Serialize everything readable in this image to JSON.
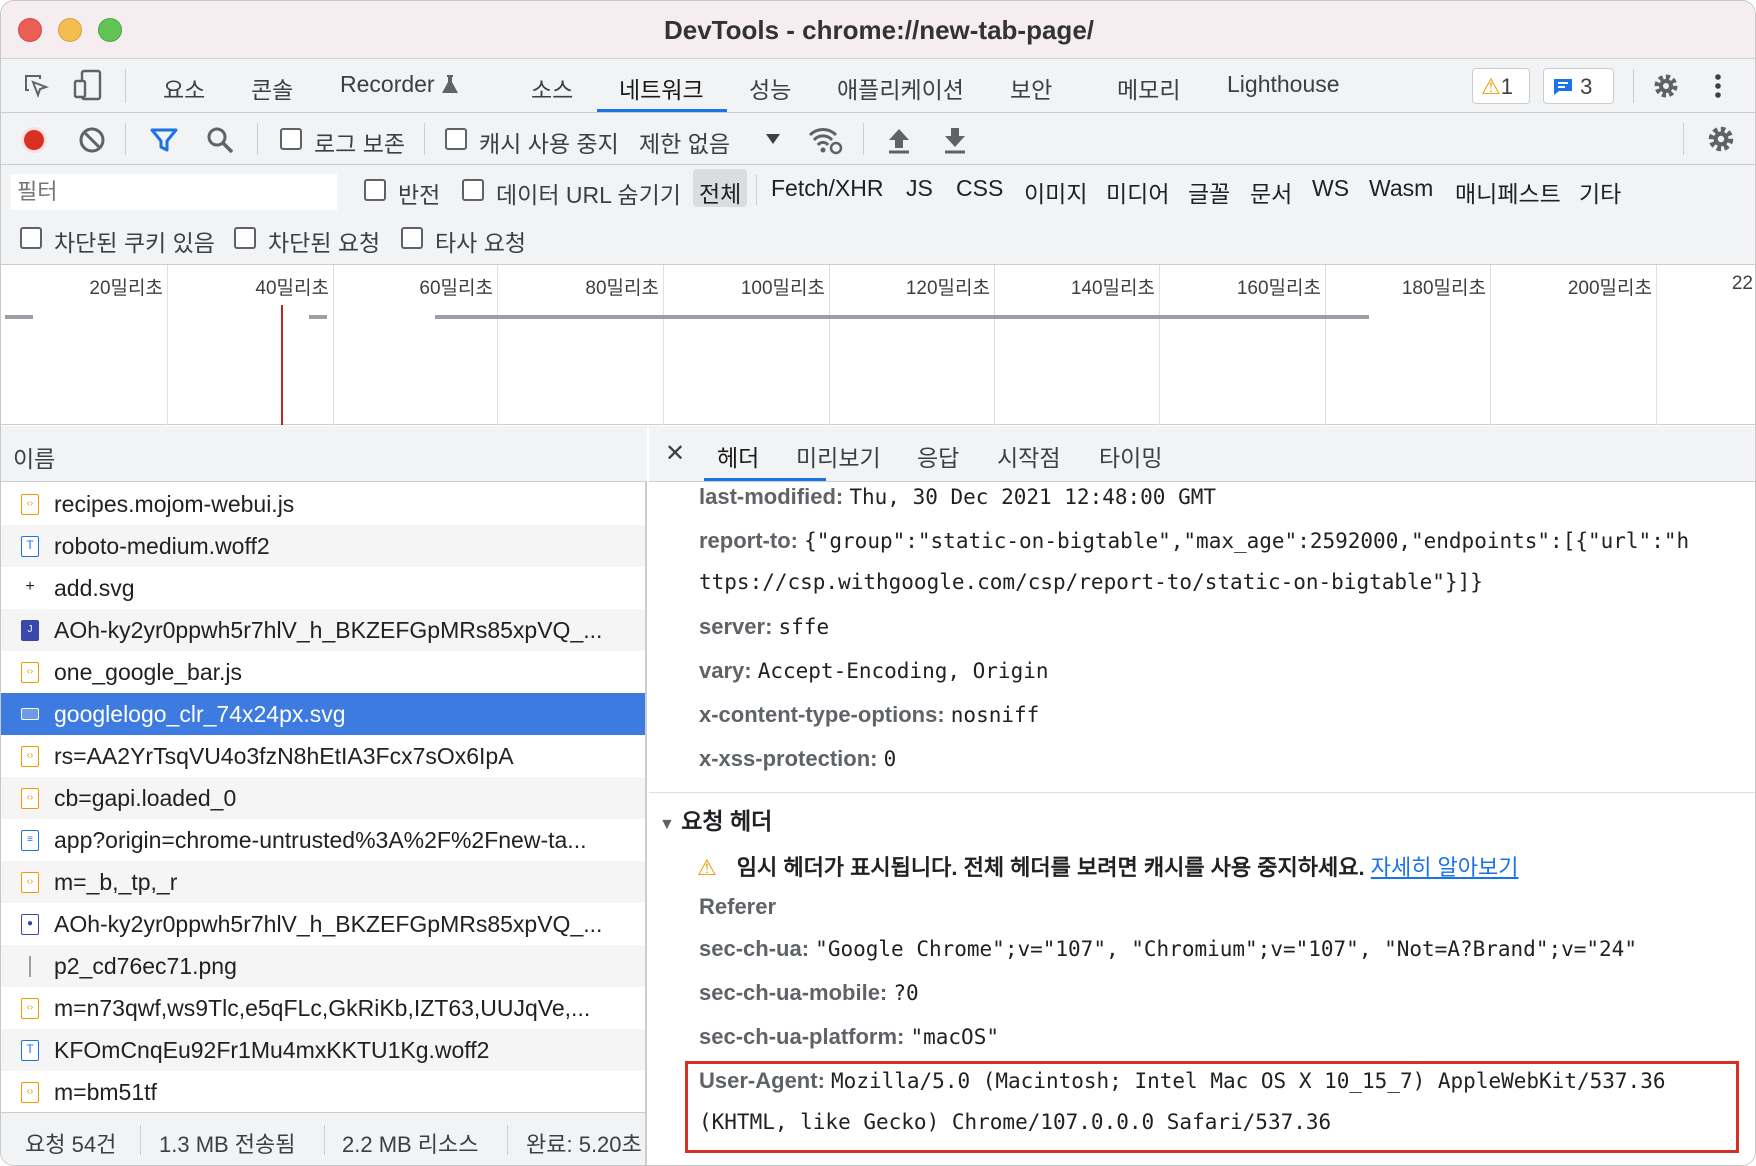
{
  "window": {
    "title": "DevTools - chrome://new-tab-page/"
  },
  "tabs": [
    {
      "label": "요소"
    },
    {
      "label": "콘솔"
    },
    {
      "label": "Recorder"
    },
    {
      "label": "소스"
    },
    {
      "label": "네트워크"
    },
    {
      "label": "성능"
    },
    {
      "label": "애플리케이션"
    },
    {
      "label": "보안"
    },
    {
      "label": "메모리"
    },
    {
      "label": "Lighthouse"
    }
  ],
  "badges": {
    "warnings": "1",
    "messages": "3"
  },
  "toolbar": {
    "preserve_log": "로그 보존",
    "disable_cache": "캐시 사용 중지",
    "throttle": "제한 없음"
  },
  "filter": {
    "placeholder": "필터",
    "invert": "반전",
    "hide_data_urls": "데이터 URL 숨기기",
    "types": [
      "전체",
      "Fetch/XHR",
      "JS",
      "CSS",
      "이미지",
      "미디어",
      "글꼴",
      "문서",
      "WS",
      "Wasm",
      "매니페스트",
      "기타"
    ],
    "blocked_cookies": "차단된 쿠키 있음",
    "blocked_requests": "차단된 요청",
    "third_party": "타사 요청"
  },
  "timeline": {
    "ticks": [
      "20밀리초",
      "40밀리초",
      "60밀리초",
      "80밀리초",
      "100밀리초",
      "120밀리초",
      "140밀리초",
      "160밀리초",
      "180밀리초",
      "200밀리초",
      "22"
    ]
  },
  "requests": {
    "header": "이름",
    "items": [
      {
        "name": "recipes.mojom-webui.js",
        "type": "js"
      },
      {
        "name": "roboto-medium.woff2",
        "type": "font"
      },
      {
        "name": "add.svg",
        "type": "svg"
      },
      {
        "name": "AOh-ky2yr0ppwh5r7hlV_h_BKZEFGpMRs85xpVQ_...",
        "type": "img"
      },
      {
        "name": "one_google_bar.js",
        "type": "js"
      },
      {
        "name": "googlelogo_clr_74x24px.svg",
        "type": "svg"
      },
      {
        "name": "rs=AA2YrTsqVU4o3fzN8hEtIA3Fcx7sOx6IpA",
        "type": "js"
      },
      {
        "name": "cb=gapi.loaded_0",
        "type": "js"
      },
      {
        "name": "app?origin=chrome-untrusted%3A%2F%2Fnew-ta...",
        "type": "doc"
      },
      {
        "name": "m=_b,_tp,_r",
        "type": "js"
      },
      {
        "name": "AOh-ky2yr0ppwh5r7hlV_h_BKZEFGpMRs85xpVQ_...",
        "type": "img2"
      },
      {
        "name": "p2_cd76ec71.png",
        "type": "png"
      },
      {
        "name": "m=n73qwf,ws9Tlc,e5qFLc,GkRiKb,IZT63,UUJqVe,...",
        "type": "js"
      },
      {
        "name": "KFOmCnqEu92Fr1Mu4mxKKTU1Kg.woff2",
        "type": "font"
      },
      {
        "name": "m=bm51tf",
        "type": "js"
      }
    ]
  },
  "status": {
    "requests": "요청 54건",
    "transferred": "1.3 MB 전송됨",
    "resources": "2.2 MB 리소스",
    "finish": "완료: 5.20초"
  },
  "detail_tabs": [
    "헤더",
    "미리보기",
    "응답",
    "시작점",
    "타이밍"
  ],
  "response_headers": [
    {
      "key": "last-modified:",
      "value": "Thu, 30 Dec 2021 12:48:00 GMT"
    },
    {
      "key": "report-to:",
      "value": "{\"group\":\"static-on-bigtable\",\"max_age\":2592000,\"endpoints\":[{\"url\":\"h",
      "cont": "ttps://csp.withgoogle.com/csp/report-to/static-on-bigtable\"}]}"
    },
    {
      "key": "server:",
      "value": "sffe"
    },
    {
      "key": "vary:",
      "value": "Accept-Encoding, Origin"
    },
    {
      "key": "x-content-type-options:",
      "value": "nosniff"
    },
    {
      "key": "x-xss-protection:",
      "value": "0"
    }
  ],
  "request_headers": {
    "title": "요청 헤더",
    "warning": "임시 헤더가 표시됩니다. 전체 헤더를 보려면 캐시를 사용 중지하세요.",
    "learn_more": "자세히 알아보기",
    "referer": "Referer",
    "items": [
      {
        "key": "sec-ch-ua:",
        "value": "\"Google Chrome\";v=\"107\", \"Chromium\";v=\"107\", \"Not=A?Brand\";v=\"24\""
      },
      {
        "key": "sec-ch-ua-mobile:",
        "value": "?0"
      },
      {
        "key": "sec-ch-ua-platform:",
        "value": "\"macOS\""
      }
    ],
    "user_agent": {
      "key": "User-Agent:",
      "value": "Mozilla/5.0 (Macintosh; Intel Mac OS X 10_15_7) AppleWebKit/537.36",
      "cont": "(KHTML, like Gecko) Chrome/107.0.0.0 Safari/537.36"
    }
  },
  "colors": {
    "accent": "#1a73e8",
    "selected_row": "#3d7be0",
    "highlight": "#d93025",
    "record": "#d93025"
  }
}
